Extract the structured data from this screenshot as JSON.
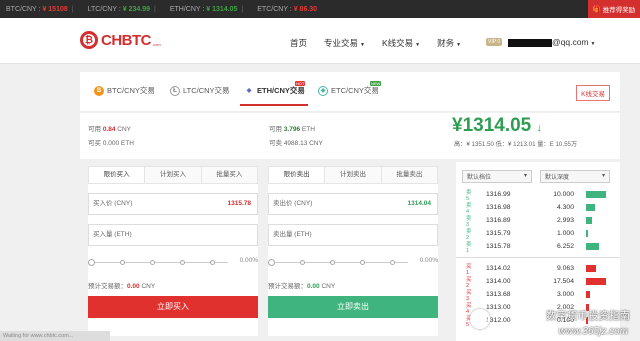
{
  "ticker": {
    "items": [
      {
        "label": "BTC/CNY :",
        "price": "¥ 15108",
        "trend": "down"
      },
      {
        "label": "LTC/CNY :",
        "price": "¥ 234.99",
        "trend": "up"
      },
      {
        "label": "ETH/CNY :",
        "price": "¥ 1314.05",
        "trend": "up"
      },
      {
        "label": "ETC/CNY :",
        "price": "¥ 86.30",
        "trend": "down"
      }
    ],
    "promo_label": "推荐得奖励"
  },
  "header": {
    "logo_text": "CHBTC",
    "logo_suffix": ".com",
    "nav": [
      "首页",
      "专业交易",
      "K线交易",
      "财务"
    ],
    "vip_badge": "VIP 0",
    "email_suffix": "@qq.com"
  },
  "market_tabs": {
    "tabs": [
      {
        "label": "BTC/CNY交易",
        "coin": "B",
        "color": "#f7931a",
        "badge": ""
      },
      {
        "label": "LTC/CNY交易",
        "coin": "Ł",
        "color": "#9e9e9e",
        "badge": ""
      },
      {
        "label": "ETH/CNY交易",
        "coin": "◆",
        "color": "#5c6bc0",
        "badge": "HOT"
      },
      {
        "label": "ETC/CNY交易",
        "coin": "◆",
        "color": "#4db6ac",
        "badge": "NEW"
      }
    ],
    "kline_label": "K线交易"
  },
  "balances": {
    "cny_available_label": "可用",
    "cny_available": "0.84",
    "cny_unit": "CNY",
    "eth_frozen_label": "可买",
    "eth_frozen": "0.000",
    "eth_unit": "ETH",
    "eth_available_label": "可用",
    "eth_available": "3.796",
    "sellable_label": "可卖",
    "sellable": "4988.13 CNY"
  },
  "price": {
    "last": "¥1314.05",
    "arrow": "↓",
    "stats": "高：¥ 1351.50   低：¥ 1213.01   量：E 10.55万"
  },
  "buy": {
    "tabs": [
      "限价买入",
      "计划买入",
      "批量买入"
    ],
    "price_label": "买入价 (CNY)",
    "price_value": "1315.78",
    "amount_label": "买入量 (ETH)",
    "pct": "0.00%",
    "est_label": "预计交易额：",
    "est_value": "0.00",
    "est_unit": "CNY",
    "button": "立即买入",
    "button_color": "#e0312f"
  },
  "sell": {
    "tabs": [
      "限价卖出",
      "计划卖出",
      "批量卖出"
    ],
    "price_label": "卖出价 (CNY)",
    "price_value": "1314.04",
    "amount_label": "卖出量 (ETH)",
    "pct": "0.00%",
    "est_label": "预计交易额：",
    "est_value": "0.00",
    "est_unit": "CNY",
    "button": "立即卖出",
    "button_color": "#3fb47f"
  },
  "orderbook": {
    "group_select": "默认档位",
    "depth_select": "默认深度",
    "asks": [
      {
        "label": "卖5",
        "price": "1316.99",
        "qty": "10.000",
        "level": 1.0
      },
      {
        "label": "卖4",
        "price": "1316.98",
        "qty": "4.300",
        "level": 0.45
      },
      {
        "label": "卖3",
        "price": "1316.89",
        "qty": "2.993",
        "level": 0.3
      },
      {
        "label": "卖2",
        "price": "1315.79",
        "qty": "1.000",
        "level": 0.1
      },
      {
        "label": "卖1",
        "price": "1315.78",
        "qty": "6.252",
        "level": 0.65
      }
    ],
    "bids": [
      {
        "label": "买1",
        "price": "1314.02",
        "qty": "9.063",
        "level": 0.5
      },
      {
        "label": "买2",
        "price": "1314.00",
        "qty": "17.504",
        "level": 1.0
      },
      {
        "label": "买3",
        "price": "1313.68",
        "qty": "3.000",
        "level": 0.2
      },
      {
        "label": "买4",
        "price": "1313.00",
        "qty": "2.002",
        "level": 0.15
      },
      {
        "label": "买5",
        "price": "1312.00",
        "qty": "0.100",
        "level": 0.05
      }
    ],
    "ask_color": "#3fb47f",
    "bid_color": "#e0312f"
  },
  "status_text": "Waiting for www.chbtc.com...",
  "watermark": {
    "line1": "数字货币投资指南",
    "line2": "www.365jz.com"
  }
}
